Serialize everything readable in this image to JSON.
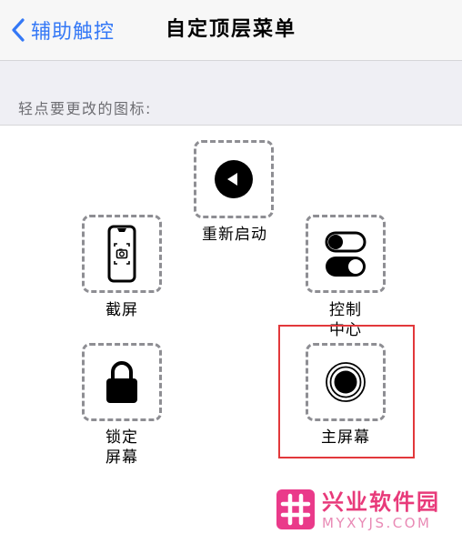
{
  "nav": {
    "back_label": "辅助触控",
    "title": "自定顶层菜单"
  },
  "section": {
    "header": "轻点要更改的图标:"
  },
  "slots": [
    {
      "id": "restart",
      "label": "重新启动",
      "icon": "play-left-circle-icon"
    },
    {
      "id": "screenshot",
      "label": "截屏",
      "icon": "screenshot-phone-icon"
    },
    {
      "id": "control-center",
      "label": "控制\n中心",
      "icon": "toggle-switches-icon"
    },
    {
      "id": "lock-screen",
      "label": "锁定\n屏幕",
      "icon": "lock-icon"
    },
    {
      "id": "home",
      "label": "主屏幕",
      "icon": "home-button-icon"
    }
  ],
  "highlighted_slot": "home",
  "watermark": {
    "name": "兴业软件园",
    "url": "MYXYJS.COM"
  },
  "colors": {
    "accent": "#3478f6",
    "highlight": "#e2383b",
    "watermark": "#e83a7a"
  }
}
